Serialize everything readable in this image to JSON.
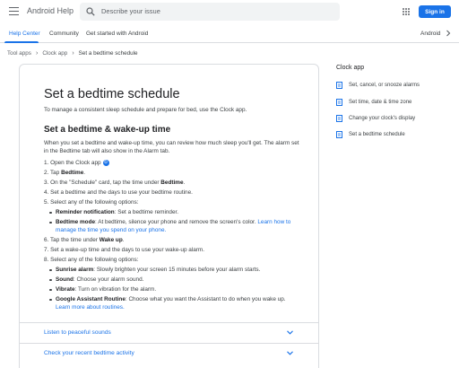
{
  "header": {
    "app_title": "Android Help",
    "search_placeholder": "Describe your issue",
    "signin_label": "Sign in"
  },
  "nav": {
    "tabs": [
      {
        "label": "Help Center",
        "active": true
      },
      {
        "label": "Community",
        "active": false
      },
      {
        "label": "Get started with Android",
        "active": false
      }
    ],
    "language": "Android"
  },
  "breadcrumb": [
    "Tool apps",
    "Clock app",
    "Set a bedtime schedule"
  ],
  "article": {
    "title": "Set a bedtime schedule",
    "intro": "To manage a consistent sleep schedule and prepare for bed, use the Clock app.",
    "section_heading": "Set a bedtime & wake-up time",
    "section_para": "When you set a bedtime and wake-up time, you can review how much sleep you'll get. The alarm set in the Bedtime tab will also show in the Alarm tab.",
    "steps": {
      "s1": "1. Open the Clock app",
      "s2_prefix": "2. Tap ",
      "s2_bold": "Bedtime",
      "s2_suffix": ".",
      "s3_prefix": "3. On the \"Schedule\" card, tap the time under ",
      "s3_bold": "Bedtime",
      "s3_suffix": ".",
      "s4": "4. Set a bedtime and the days to use your bedtime routine.",
      "s5": "5. Select any of the following options:",
      "s5_a_bold": "Reminder notification",
      "s5_a_text": ": Set a bedtime reminder.",
      "s5_b_bold": "Bedtime mode",
      "s5_b_text": ": At bedtime, silence your phone and remove the screen's color. ",
      "s5_b_link": "Learn how to manage the time you spend on your phone.",
      "s6_prefix": "6. Tap the time under ",
      "s6_bold": "Wake up",
      "s6_suffix": ".",
      "s7": "7. Set a wake-up time and the days to use your wake-up alarm.",
      "s8": "8. Select any of the following options:",
      "s8_a_bold": "Sunrise alarm",
      "s8_a_text": ": Slowly brighten your screen 15 minutes before your alarm starts.",
      "s8_b_bold": "Sound",
      "s8_b_text": ": Choose your alarm sound.",
      "s8_c_bold": "Vibrate",
      "s8_c_text": ": Turn on vibration for the alarm.",
      "s8_d_bold": "Google Assistant Routine",
      "s8_d_text": ": Choose what you want the Assistant to do when you wake up. ",
      "s8_d_link": "Learn more about routines."
    },
    "expanders": [
      "Listen to peaceful sounds",
      "Check your recent bedtime activity"
    ]
  },
  "sidebar": {
    "title": "Clock app",
    "items": [
      "Set, cancel, or snooze alarms",
      "Set time, date & time zone",
      "Change your clock's display",
      "Set a bedtime schedule"
    ]
  },
  "colors": {
    "accent": "#1a73e8",
    "text": "#202124",
    "border": "#dadce0"
  }
}
